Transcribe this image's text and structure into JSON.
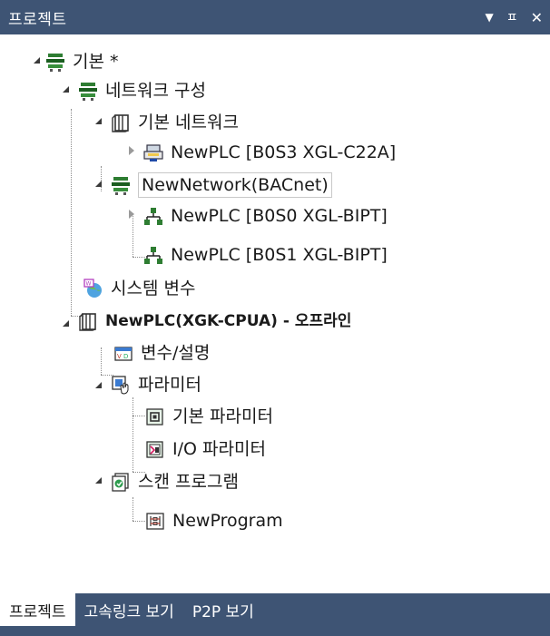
{
  "panel": {
    "title": "프로젝트",
    "menu_glyph": "▼",
    "pin_glyph": "ㅍ",
    "close_glyph": "✕"
  },
  "tree": {
    "root": "기본 *",
    "network_config": "네트워크 구성",
    "basic_network": "기본 네트워크",
    "plc_b0s3": "NewPLC [B0S3 XGL-C22A]",
    "new_network": "NewNetwork(BACnet)",
    "plc_b0s0": "NewPLC [B0S0 XGL-BIPT]",
    "plc_b0s1": "NewPLC [B0S1 XGL-BIPT]",
    "system_vars": "시스템 변수",
    "plc_main": "NewPLC(XGK-CPUA)",
    "plc_main_status": " - 오프라인",
    "vars_desc": "변수/설명",
    "parameters": "파라미터",
    "basic_params": "기본 파라미터",
    "io_params": "I/O 파라미터",
    "scan_program": "스캔 프로그램",
    "new_program": "NewProgram"
  },
  "tabs": [
    "프로젝트",
    "고속링크 보기",
    "P2P 보기"
  ]
}
